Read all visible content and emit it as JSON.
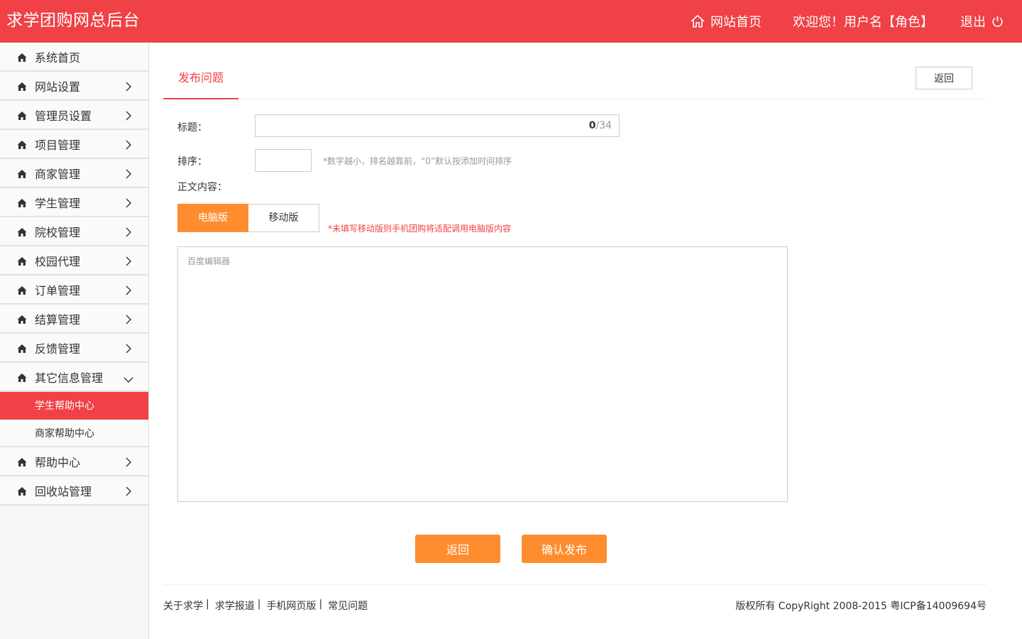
{
  "header": {
    "logo": "求学团购网总后台",
    "home_link": "网站首页",
    "welcome": "欢迎您！用户名【角色】",
    "logout": "退出"
  },
  "sidebar": {
    "items": [
      {
        "label": "系统首页",
        "chevron": "none"
      },
      {
        "label": "网站设置",
        "chevron": "right"
      },
      {
        "label": "管理员设置",
        "chevron": "right"
      },
      {
        "label": "项目管理",
        "chevron": "right"
      },
      {
        "label": "商家管理",
        "chevron": "right"
      },
      {
        "label": "学生管理",
        "chevron": "right"
      },
      {
        "label": "院校管理",
        "chevron": "right"
      },
      {
        "label": "校园代理",
        "chevron": "right"
      },
      {
        "label": "订单管理",
        "chevron": "right"
      },
      {
        "label": "结算管理",
        "chevron": "right"
      },
      {
        "label": "反馈管理",
        "chevron": "right"
      },
      {
        "label": "其它信息管理",
        "chevron": "down"
      },
      {
        "label": "帮助中心",
        "chevron": "right"
      },
      {
        "label": "回收站管理",
        "chevron": "right"
      }
    ],
    "sub_items": [
      {
        "label": "学生帮助中心",
        "active": true
      },
      {
        "label": "商家帮助中心",
        "active": false
      }
    ]
  },
  "main": {
    "tab": "发布问题",
    "back_top": "返回",
    "title_label": "标题：",
    "title_count": "0",
    "title_max": "/34",
    "order_label": "排序：",
    "order_hint": "*数字越小，排名越靠前，“0”默认按添加时间排序",
    "content_label": "正文内容：",
    "seg_pc": "电脑版",
    "seg_mobile": "移动版",
    "warn": "*未填写移动版则手机团购将适配调用电脑版内容",
    "editor_placeholder": "百度编辑器",
    "btn_back": "返回",
    "btn_publish": "确认发布"
  },
  "footer": {
    "links": [
      "关于求学",
      "求学报道",
      "手机网页版",
      "常见问题"
    ],
    "copyright": "版权所有 CopyRight 2008-2015 粤ICP备14009694号"
  },
  "colors": {
    "brand_red": "#ef4146",
    "accent_orange": "#ff8c2e"
  },
  "icons": {
    "home": "home-icon",
    "power": "power-icon",
    "chevron_right": "chevron-right-icon",
    "chevron_down": "chevron-down-icon"
  }
}
